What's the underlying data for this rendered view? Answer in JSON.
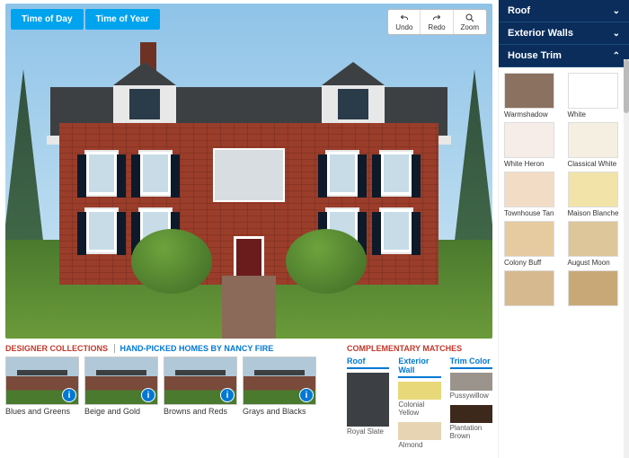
{
  "topbar": {
    "time_of_day": "Time of Day",
    "time_of_year": "Time of Year"
  },
  "toolbar": {
    "undo": "Undo",
    "redo": "Redo",
    "zoom": "Zoom"
  },
  "accordion": {
    "roof": "Roof",
    "walls": "Exterior Walls",
    "trim": "House Trim"
  },
  "palette": [
    {
      "name": "Warmshadow",
      "hex": "#8b7160"
    },
    {
      "name": "White",
      "hex": "#ffffff"
    },
    {
      "name": "White Heron",
      "hex": "#f6ece8"
    },
    {
      "name": "Classical White",
      "hex": "#f4efe0"
    },
    {
      "name": "Townhouse Tan",
      "hex": "#f2dcc6"
    },
    {
      "name": "Maison Blanche",
      "hex": "#f2e3a8"
    },
    {
      "name": "Colony Buff",
      "hex": "#e6caa0"
    },
    {
      "name": "August Moon",
      "hex": "#dcc69a"
    },
    {
      "name": "",
      "hex": "#d6b98e"
    },
    {
      "name": "",
      "hex": "#c9a878"
    }
  ],
  "designer": {
    "header_left": "DESIGNER COLLECTIONS",
    "header_right": "HAND-PICKED HOMES BY NANCY FIRE",
    "items": [
      {
        "label": "Blues and Greens"
      },
      {
        "label": "Beige and Gold"
      },
      {
        "label": "Browns and Reds"
      },
      {
        "label": "Grays and Blacks"
      }
    ]
  },
  "complementary": {
    "header": "COMPLEMENTARY MATCHES",
    "cols": [
      {
        "title": "Roof",
        "swatches": [
          {
            "label": "Royal Slate",
            "hex": "#3c4044"
          }
        ]
      },
      {
        "title": "Exterior Wall",
        "swatches": [
          {
            "label": "Colonial Yellow",
            "hex": "#e8d87a"
          },
          {
            "label": "Almond",
            "hex": "#e6d4b2"
          }
        ]
      },
      {
        "title": "Trim Color",
        "swatches": [
          {
            "label": "Pussywillow",
            "hex": "#9a948c"
          },
          {
            "label": "Plantation Brown",
            "hex": "#3d281c"
          }
        ]
      }
    ]
  }
}
